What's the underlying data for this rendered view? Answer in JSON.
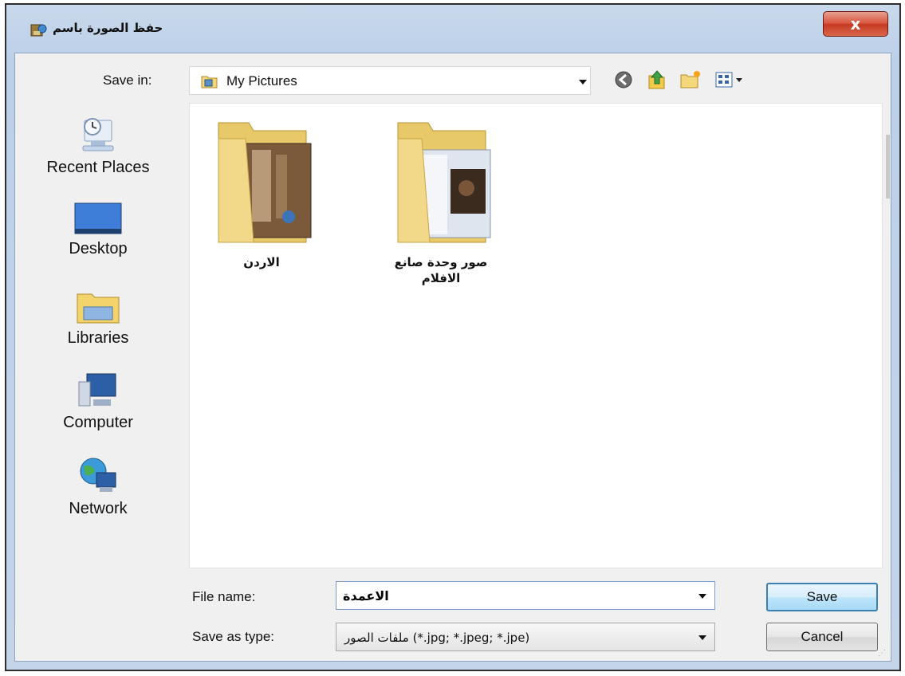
{
  "window": {
    "title": "حفظ الصورة باسم",
    "close_label": "x"
  },
  "toolbar": {
    "save_in_label": "Save in:",
    "save_in_value": "My Pictures"
  },
  "places": [
    {
      "label": "Recent Places"
    },
    {
      "label": "Desktop"
    },
    {
      "label": "Libraries"
    },
    {
      "label": "Computer"
    },
    {
      "label": "Network"
    }
  ],
  "files": [
    {
      "name": "الاردن"
    },
    {
      "name": "صور وحدة صانع الافلام"
    }
  ],
  "form": {
    "file_name_label": "File name:",
    "file_name_value": "الاعمدة",
    "save_as_type_label": "Save as type:",
    "save_as_type_value": "ملفات الصور (*.jpg; *.jpeg; *.jpe)"
  },
  "buttons": {
    "save": "Save",
    "cancel": "Cancel"
  },
  "colors": {
    "close_button": "#d9553e",
    "default_button_border": "#3c7fb1",
    "window_chrome": "#c4d5ea"
  }
}
